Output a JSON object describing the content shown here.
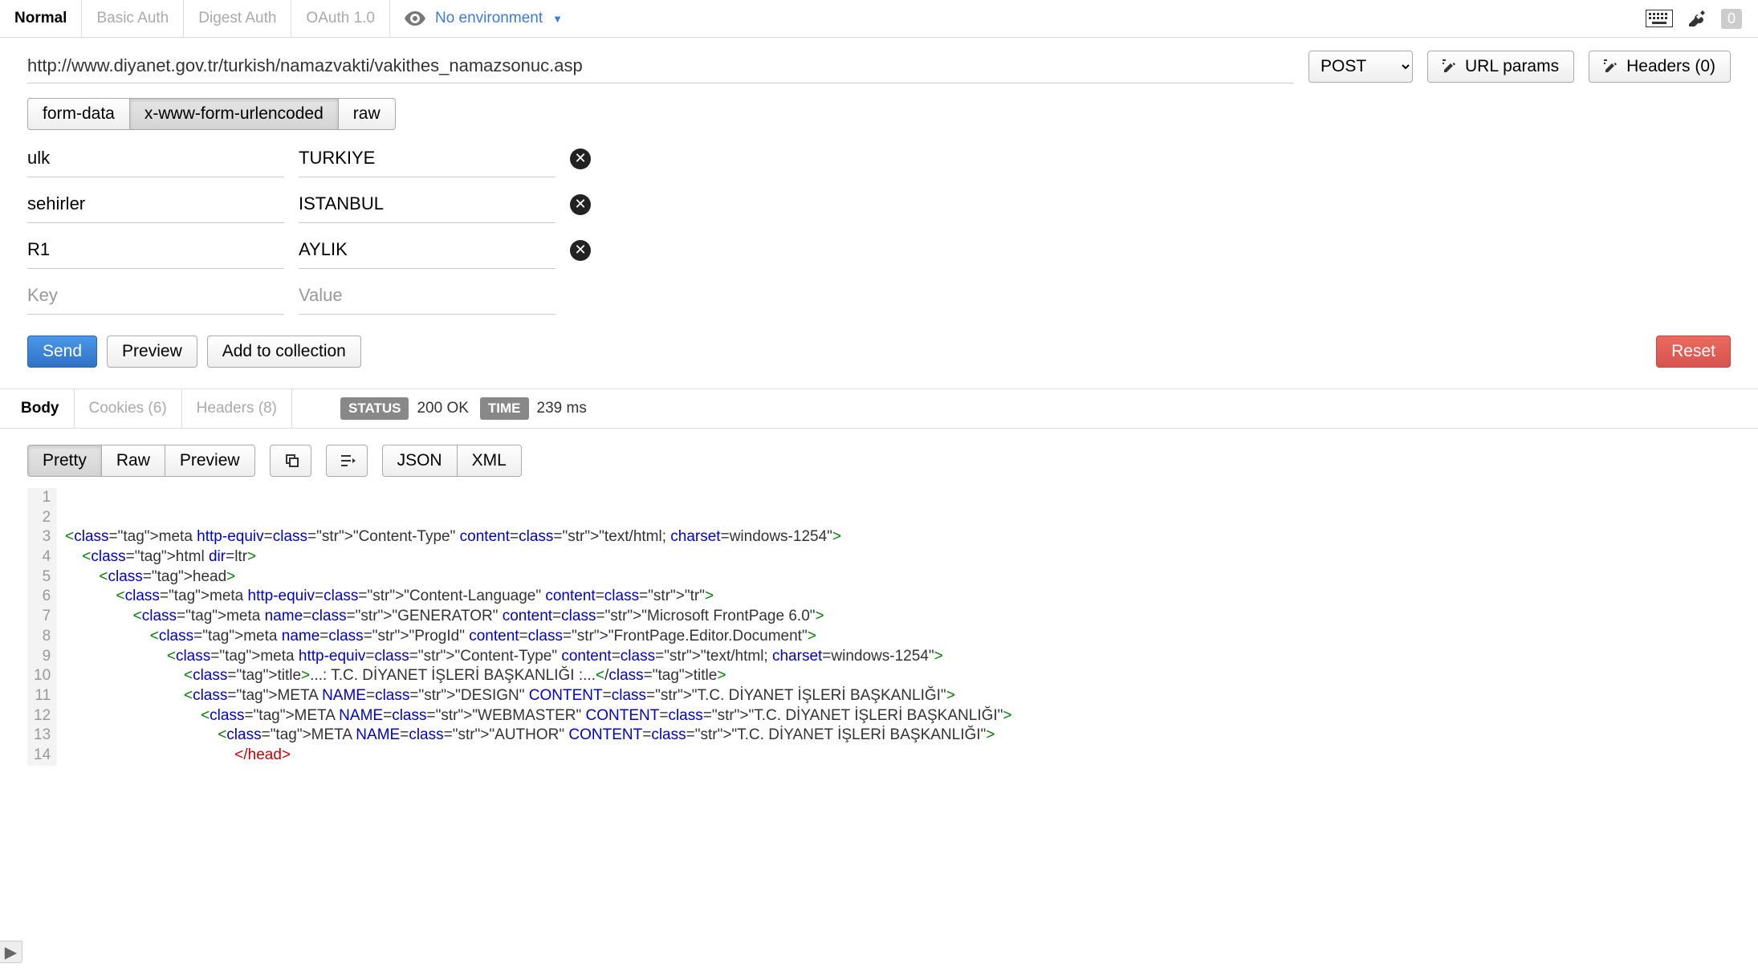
{
  "auth_tabs": {
    "normal": "Normal",
    "basic": "Basic Auth",
    "digest": "Digest Auth",
    "oauth": "OAuth 1.0"
  },
  "environment": {
    "label": "No environment"
  },
  "counter_badge": "0",
  "request": {
    "url": "http://www.diyanet.gov.tr/turkish/namazvakti/vakithes_namazsonuc.asp",
    "method": "POST",
    "url_params_label": "URL params",
    "headers_label": "Headers (0)"
  },
  "body_type": {
    "form_data": "form-data",
    "urlencoded": "x-www-form-urlencoded",
    "raw": "raw"
  },
  "params": [
    {
      "key": "ulk",
      "value": "TURKIYE"
    },
    {
      "key": "sehirler",
      "value": "ISTANBUL"
    },
    {
      "key": "R1",
      "value": "AYLIK"
    }
  ],
  "param_placeholders": {
    "key": "Key",
    "value": "Value"
  },
  "actions": {
    "send": "Send",
    "preview": "Preview",
    "add": "Add to collection",
    "reset": "Reset"
  },
  "response_tabs": {
    "body": "Body",
    "cookies": "Cookies (6)",
    "headers": "Headers (8)"
  },
  "response_meta": {
    "status_label": "STATUS",
    "status_val": "200 OK",
    "time_label": "TIME",
    "time_val": "239 ms"
  },
  "format_tabs": {
    "pretty": "Pretty",
    "raw": "Raw",
    "preview": "Preview",
    "json": "JSON",
    "xml": "XML"
  },
  "code_lines": [
    "",
    "",
    "<meta http-equiv=\"Content-Type\" content=\"text/html; charset=windows-1254\">",
    "    <html dir=ltr>",
    "        <head>",
    "            <meta http-equiv=\"Content-Language\" content=\"tr\">",
    "                <meta name=\"GENERATOR\" content=\"Microsoft FrontPage 6.0\">",
    "                    <meta name=\"ProgId\" content=\"FrontPage.Editor.Document\">",
    "                        <meta http-equiv=\"Content-Type\" content=\"text/html; charset=windows-1254\">",
    "                            <title>...: T.C. DİYANET İŞLERİ BAŞKANLIĞI :...</title>",
    "                            <META NAME=\"DESIGN\" CONTENT=\"T.C. DİYANET İŞLERİ BAŞKANLIĞI\">",
    "                                <META NAME=\"WEBMASTER\" CONTENT=\"T.C. DİYANET İŞLERİ BAŞKANLIĞI\">",
    "                                    <META NAME=\"AUTHOR\" CONTENT=\"T.C. DİYANET İŞLERİ BAŞKANLIĞI\">",
    "                                        </head>"
  ]
}
